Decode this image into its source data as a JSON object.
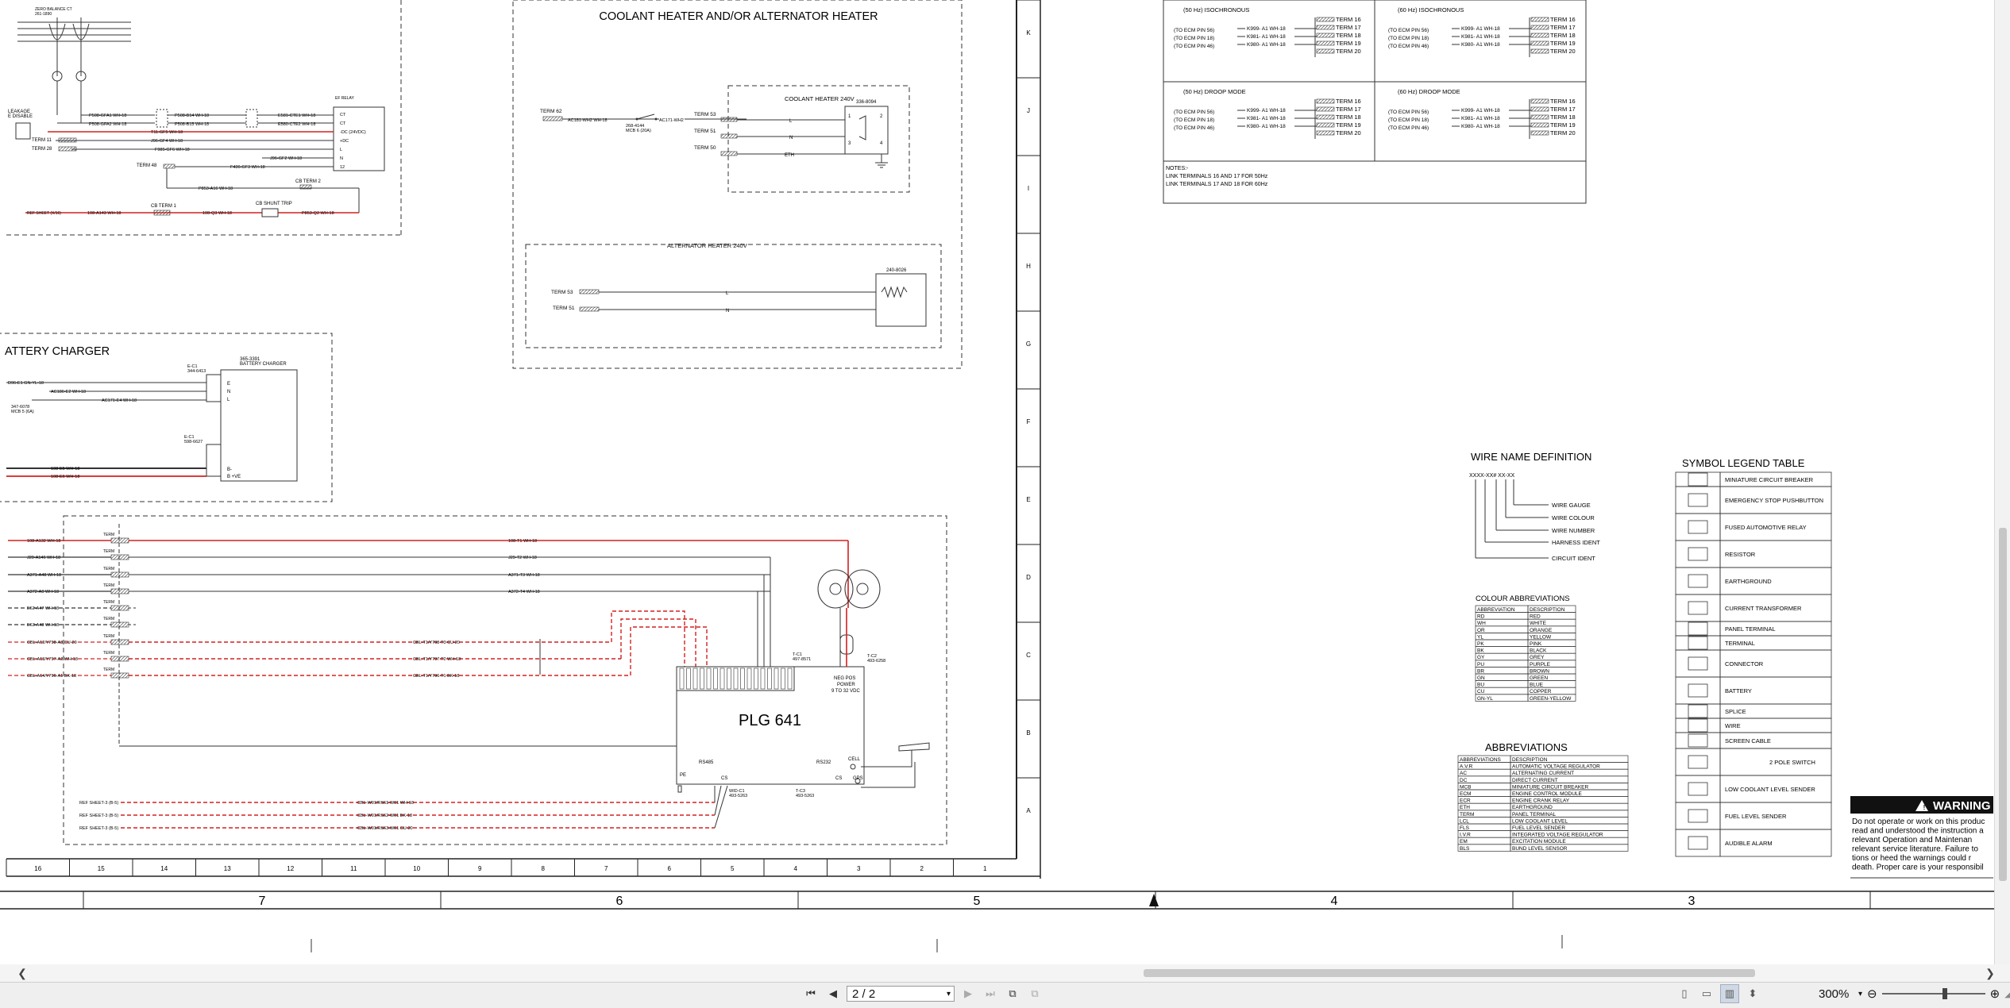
{
  "drawing": {
    "zone_numbers": [
      "16",
      "15",
      "14",
      "13",
      "12",
      "11",
      "10",
      "9",
      "8",
      "7",
      "6",
      "5",
      "4",
      "3",
      "2",
      "1"
    ],
    "zone_letters": [
      "K",
      "J",
      "I",
      "H",
      "G",
      "F",
      "E",
      "D",
      "C",
      "B",
      "A"
    ],
    "sheet_numbers": [
      "7",
      "6",
      "5",
      "4",
      "3"
    ],
    "coolant_heater": {
      "title": "COOLANT HEATER AND/OR ALTERNATOR HEATER",
      "coolant_box_label": "COOLANT HEATER 240V",
      "coolant_part": "336-8094",
      "term_62": "TERM 62",
      "term_53": "TERM 53",
      "term_51": "TERM 51",
      "term_50": "TERM 50",
      "wire_ac181": "AC181-WH2 WH-18",
      "wire_ac171": "AC171-WH2",
      "mcb_label": "MCB 6 (20A)",
      "mcb_part": "268-4144",
      "alt_box_label": "ALTERNATOR HEATER 240V",
      "alt_part": "240-8026",
      "alt_term_53": "TERM 53",
      "alt_term_51": "TERM 51",
      "label_L": "L",
      "label_N": "N",
      "label_ETH": "ETH"
    },
    "battery_charger": {
      "title": "ATTERY CHARGER",
      "charger_label": "BATTERY CHARGER",
      "charger_part": "365-3391",
      "ec1": "E-C1",
      "ec1_part": "344-6413",
      "ec2": "E-C1",
      "ec2_part": "598-6627",
      "wire_e1": "D96-E1 GN-YL-18",
      "wire_e2": "AC186-E2 WH-18",
      "wire_e4": "AC171-E4 WH-18",
      "wire_e5": "108-E5 WH-18",
      "wire_e6": "108-E6 WH-18",
      "mcb": "MCB 5 (6A)",
      "mcb_part": "347-6078"
    },
    "top_left": {
      "ct_label": "ZERO BALANCE CT",
      "ct_part": "261-1890",
      "leakage": "LEAKAGE",
      "leakage2": "E DISABLE",
      "term11": "TERM 11",
      "term28": "TERM 28",
      "term48": "TERM 48",
      "cb_term2": "CB TERM 2",
      "cb_term1": "CB TERM 1",
      "cb_shunt": "CB SHUNT TRIP",
      "ref_sheet": "REF SHEET (X/16)",
      "relay_label": "EF RELAY",
      "wires": [
        "P508-GFA1 WH-18",
        "P508-GFA2 WH-18",
        "T11-GF5 WH-18",
        "J96-GF4 WH-18",
        "F985-GF6 WH-18",
        "F436-GF3 WH-18",
        "P853-A16 WH-18",
        "108-A143 WH-18",
        "108-Q3 WH-18",
        "P853-Q2 WH-18",
        "P508-B14 WH-18",
        "P508-B15 WH-18",
        "E581-CTE1 WH-18",
        "E580-CTE2 WH-18",
        "J96-GF2 WH-18"
      ],
      "relay_pins": [
        "CT",
        "CT",
        "-DC (24VDC)",
        "+DC",
        "L",
        "N",
        "12"
      ]
    },
    "plg": {
      "title": "PLG 641",
      "neg_pos": "NEG POS",
      "power": "POWER",
      "vdc": "9 TO 32 VDC",
      "t_c1": "T-C1",
      "t_c1_part": "497-8571",
      "t_c2": "T-C2",
      "t_c2_part": "493-6258",
      "rs485": "RS485",
      "rs232": "RS232",
      "cell": "CELL",
      "gps": "GPS",
      "pe": "PE",
      "cs": "CS",
      "wid_c1": "WID-C1",
      "wid_part": "493-5263",
      "t_c3": "T-C3",
      "t_c3_part": "493-5263",
      "term_label": "TERM",
      "left_wires": [
        "108-A132 WH-18",
        "J29-A146 WH-18",
        "A371-A48 WH-18",
        "A372-A0 WH-18",
        "E62-A47 WH-18",
        "E63-A48 WH-18",
        "CBL-A12/Y798-A3 CU-20",
        "CBL-A13/Y797-A2 WH-18",
        "CBL-A14/Y796-A1 BK-18"
      ],
      "mid_wires": [
        "108-T1 WH-18",
        "J29-T2 WH-18",
        "A371-T3 WH-18",
        "A372-T4 WH-18",
        "CBL-T1/Y798-T3 CU-20",
        "CBL-T1/Y797-T2 WH-18",
        "CBL-T1/Y796-T1 BK-18"
      ],
      "ref_rows": [
        "REF SHEET-3 (B-5)",
        "REF SHEET-3 (B-5)",
        "REF SHEET-3 (B-5)"
      ],
      "ref_wires": [
        "CBL-W01/RS61-W01 WH-18",
        "CBL-W01/RS62-W01 BK-18",
        "CBL-W01/RS63-W01 CU-20"
      ]
    },
    "droop": {
      "sync50_title": "(50 Hz) ISOCHRONOUS",
      "sync60_title": "(60 Hz) ISOCHRONOUS",
      "droop50_title": "(50 Hz) DROOP MODE",
      "droop60_title": "(60 Hz) DROOP MODE",
      "pins": [
        "(TO ECM PIN 56)",
        "(TO ECM PIN 18)",
        "(TO ECM PIN 46)"
      ],
      "wires": [
        "K999- A1 WH-18",
        "K981- A1 WH-18",
        "K980- A1 WH-18"
      ],
      "terms": [
        "TERM 16",
        "TERM 17",
        "TERM 18",
        "TERM 19",
        "TERM 20"
      ],
      "notes_title": "NOTES:-",
      "note1": "LINK TERMINALS 16 AND 17 FOR 50Hz",
      "note2": "LINK TERMINALS 17 AND 18 FOR 60Hz"
    },
    "wire_name": {
      "title": "WIRE NAME DEFINITION",
      "format": "XXXX-XX# XX-XX",
      "items": [
        "WIRE GAUGE",
        "WIRE COLOUR",
        "WIRE NUMBER",
        "HARNESS IDENT",
        "CIRCUIT IDENT"
      ]
    },
    "colour_abbrev": {
      "title": "COLOUR ABBREVIATIONS",
      "headers": [
        "ABBREVIATION",
        "DESCRIPTION"
      ],
      "rows": [
        [
          "RD",
          "RED"
        ],
        [
          "WH",
          "WHITE"
        ],
        [
          "OR",
          "ORANGE"
        ],
        [
          "YL",
          "YELLOW"
        ],
        [
          "PK",
          "PINK"
        ],
        [
          "BK",
          "BLACK"
        ],
        [
          "GY",
          "GREY"
        ],
        [
          "PU",
          "PURPLE"
        ],
        [
          "BR",
          "BROWN"
        ],
        [
          "GN",
          "GREEN"
        ],
        [
          "BU",
          "BLUE"
        ],
        [
          "CU",
          "COPPER"
        ],
        [
          "GN-YL",
          "GREEN-YELLOW"
        ]
      ]
    },
    "abbreviations": {
      "title": "ABBREVIATIONS",
      "headers": [
        "ABBREVIATIONS",
        "DESCRIPTION"
      ],
      "rows": [
        [
          "A.V.R",
          "AUTOMATIC VOLTAGE REGULATOR"
        ],
        [
          "AC",
          "ALTERNATING CURRENT"
        ],
        [
          "DC",
          "DIRECT CURRENT"
        ],
        [
          "MCB",
          "MINIATURE CIRCUIT BREAKER"
        ],
        [
          "ECM",
          "ENGINE CONTROL MODULE"
        ],
        [
          "ECR",
          "ENGINE CRANK RELAY"
        ],
        [
          "ETH",
          "EARTHGROUND"
        ],
        [
          "TERM",
          "PANEL TERMINAL"
        ],
        [
          "LCL",
          "LOW COOLANT LEVEL"
        ],
        [
          "FLS",
          "FUEL LEVEL SENDER"
        ],
        [
          "I.V.R",
          "INTEGRATED VOLTAGE REGULATOR"
        ],
        [
          "EM",
          "EXCITATION MODULE"
        ],
        [
          "BLS",
          "BUND LEVEL SENSOR"
        ]
      ]
    },
    "symbol_legend": {
      "title": "SYMBOL LEGEND TABLE",
      "items": [
        "MINIATURE CIRCUIT BREAKER",
        "EMERGENCY STOP PUSHBUTTON",
        "FUSED AUTOMOTIVE RELAY",
        "RESISTOR",
        "EARTHGROUND",
        "CURRENT TRANSFORMER",
        "PANEL TERMINAL",
        "TERMINAL",
        "CONNECTOR",
        "BATTERY",
        "SPLICE",
        "WIRE",
        "SCREEN CABLE",
        "2 POLE SWITCH",
        "LOW COOLANT LEVEL SENDER",
        "FUEL LEVEL SENDER",
        "AUDIBLE ALARM"
      ]
    },
    "warning": {
      "title": "WARNING",
      "lines": [
        "Do not operate or work on this produc",
        "read and understood the instruction a",
        "relevant Operation and Maintenan",
        "relevant service literature. Failure to",
        "tions or heed the warnings could r",
        "death. Proper care is your responsibil"
      ]
    },
    "colors": {
      "red": "#d42020",
      "line": "#222222",
      "dash": "#333333"
    }
  },
  "viewer": {
    "page_value": "2 / 2",
    "zoom": "300%",
    "zoom_level": 0.62
  }
}
